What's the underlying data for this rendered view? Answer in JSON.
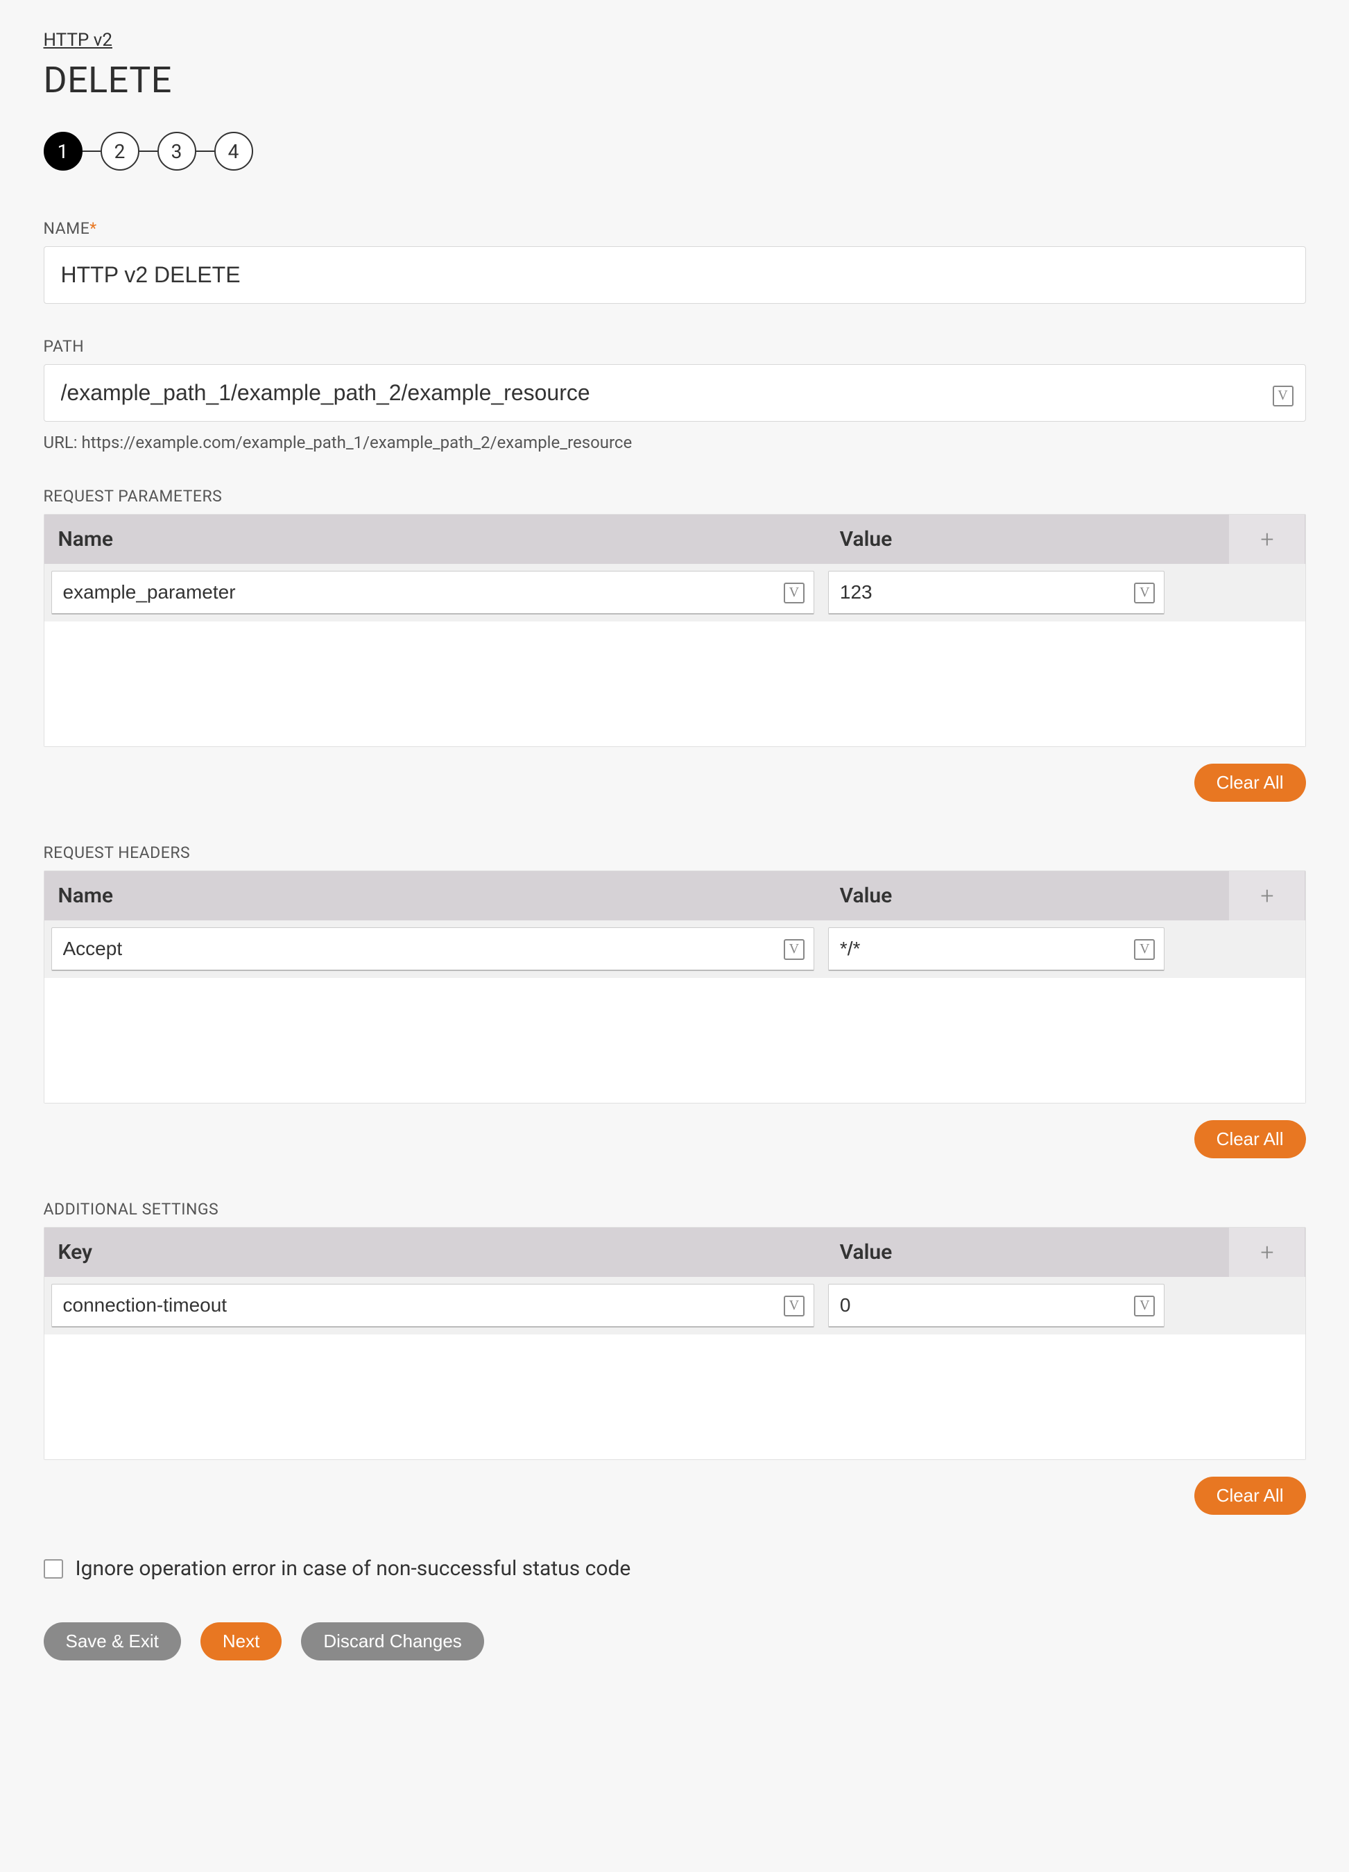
{
  "breadcrumb": "HTTP v2",
  "title": "DELETE",
  "stepper": {
    "steps": [
      "1",
      "2",
      "3",
      "4"
    ],
    "active": 0
  },
  "fields": {
    "name_label": "NAME",
    "name_value": "HTTP v2 DELETE",
    "path_label": "PATH",
    "path_value": "/example_path_1/example_path_2/example_resource",
    "url_hint": "URL: https://example.com/example_path_1/example_path_2/example_resource"
  },
  "sections": {
    "params": {
      "label": "REQUEST PARAMETERS",
      "header_name": "Name",
      "header_value": "Value",
      "row": {
        "name": "example_parameter",
        "value": "123"
      },
      "clear": "Clear All"
    },
    "headers": {
      "label": "REQUEST HEADERS",
      "header_name": "Name",
      "header_value": "Value",
      "row": {
        "name": "Accept",
        "value": "*/*"
      },
      "clear": "Clear All"
    },
    "additional": {
      "label": "ADDITIONAL SETTINGS",
      "header_key": "Key",
      "header_value": "Value",
      "row": {
        "key": "connection-timeout",
        "value": "0"
      },
      "clear": "Clear All"
    }
  },
  "ignore_error_label": "Ignore operation error in case of non-successful status code",
  "buttons": {
    "save_exit": "Save & Exit",
    "next": "Next",
    "discard": "Discard Changes"
  },
  "icons": {
    "variable": "V",
    "plus": "+"
  }
}
